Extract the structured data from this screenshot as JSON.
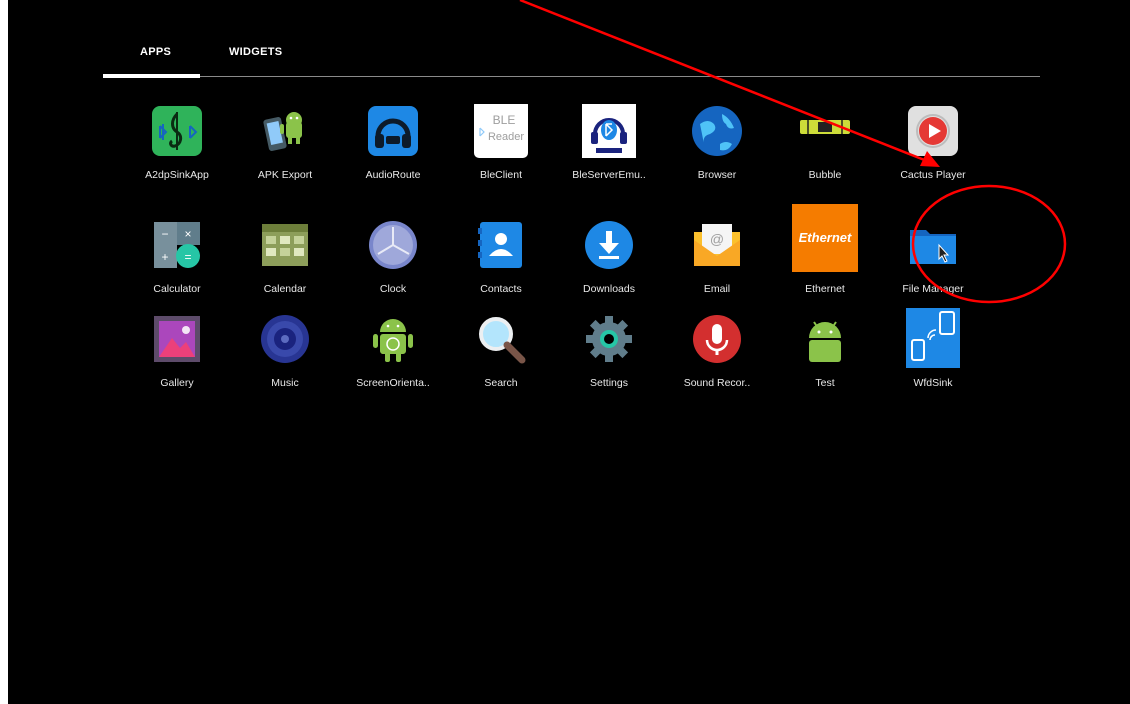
{
  "tabs": [
    {
      "label": "APPS",
      "selected": true
    },
    {
      "label": "WIDGETS",
      "selected": false
    }
  ],
  "apps": [
    {
      "label": "A2dpSinkApp",
      "icon": "a2dp-sink-icon"
    },
    {
      "label": "APK Export",
      "icon": "apk-export-icon"
    },
    {
      "label": "AudioRoute",
      "icon": "audio-route-icon"
    },
    {
      "label": "BleClient",
      "icon": "ble-reader-icon",
      "icon_text": [
        "BLE",
        "Reader"
      ]
    },
    {
      "label": "BleServerEmu..",
      "icon": "ble-server-icon"
    },
    {
      "label": "Browser",
      "icon": "browser-globe-icon"
    },
    {
      "label": "Bubble",
      "icon": "bubble-level-icon"
    },
    {
      "label": "Cactus Player",
      "icon": "cactus-player-icon"
    },
    {
      "label": "Calculator",
      "icon": "calculator-icon"
    },
    {
      "label": "Calendar",
      "icon": "calendar-icon"
    },
    {
      "label": "Clock",
      "icon": "clock-icon"
    },
    {
      "label": "Contacts",
      "icon": "contacts-icon"
    },
    {
      "label": "Downloads",
      "icon": "downloads-icon"
    },
    {
      "label": "Email",
      "icon": "email-icon"
    },
    {
      "label": "Ethernet",
      "icon": "ethernet-icon",
      "icon_text": [
        "Ethernet"
      ]
    },
    {
      "label": "File Manager",
      "icon": "file-manager-folder-icon"
    },
    {
      "label": "Gallery",
      "icon": "gallery-icon"
    },
    {
      "label": "Music",
      "icon": "music-speaker-icon"
    },
    {
      "label": "ScreenOrienta..",
      "icon": "screen-orientation-icon"
    },
    {
      "label": "Search",
      "icon": "search-magnifier-icon"
    },
    {
      "label": "Settings",
      "icon": "settings-gear-icon"
    },
    {
      "label": "Sound Recor..",
      "icon": "sound-recorder-icon"
    },
    {
      "label": "Test",
      "icon": "test-android-icon"
    },
    {
      "label": "WfdSink",
      "icon": "wfd-sink-icon"
    }
  ],
  "annotation": {
    "color": "#ff0000",
    "target": "File Manager"
  },
  "colors": {
    "background": "#000000",
    "text": "#e8e8e8"
  }
}
